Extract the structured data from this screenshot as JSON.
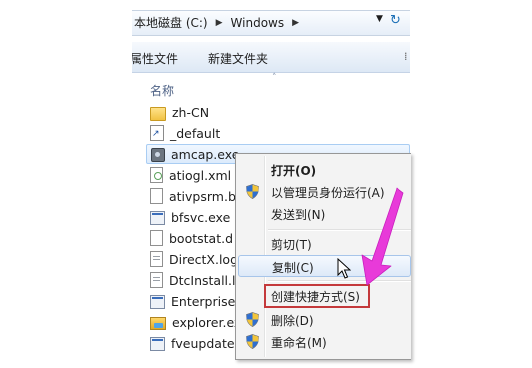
{
  "address": {
    "crumbs": [
      "本地磁盘 (C:)",
      "Windows"
    ],
    "separator_glyph": "▶",
    "dropdown_glyph": "▼",
    "refresh_glyph": "↻"
  },
  "toolbar": {
    "properties_label": "属性文件",
    "new_folder_label": "新建文件夹",
    "overflow_glyph": "⁞"
  },
  "list_header": {
    "name_label": "名称",
    "sort_glyph": "˄"
  },
  "files": [
    {
      "name": "zh-CN",
      "icon": "folder"
    },
    {
      "name": "_default",
      "icon": "shortcut"
    },
    {
      "name": "amcap.exe",
      "icon": "camera-exe",
      "selected": true
    },
    {
      "name": "atiogl.xml",
      "icon": "xml"
    },
    {
      "name": "ativpsrm.b",
      "icon": "document"
    },
    {
      "name": "bfsvc.exe",
      "icon": "exe"
    },
    {
      "name": "bootstat.d",
      "icon": "document"
    },
    {
      "name": "DirectX.log",
      "icon": "log"
    },
    {
      "name": "DtcInstall.l",
      "icon": "log"
    },
    {
      "name": "Enterprise.",
      "icon": "exe"
    },
    {
      "name": "explorer.ex",
      "icon": "explorer"
    },
    {
      "name": "fveupdate.",
      "icon": "exe"
    }
  ],
  "context_menu": {
    "items": [
      {
        "label": "打开(O)",
        "bold": true,
        "icon": ""
      },
      {
        "label": "以管理员身份运行(A)",
        "icon": "uac-shield-icon"
      },
      {
        "label": "发送到(N)",
        "icon": ""
      },
      {
        "label": "剪切(T)",
        "icon": ""
      },
      {
        "label": "复制(C)",
        "icon": "",
        "hover": true
      },
      {
        "label": "创建快捷方式(S)",
        "icon": "",
        "highlighted": true
      },
      {
        "label": "删除(D)",
        "icon": "uac-shield-icon"
      },
      {
        "label": "重命名(M)",
        "icon": "uac-shield-icon"
      }
    ]
  },
  "colors": {
    "annotation_arrow": "#e83ad9",
    "highlight_box": "#c4393b",
    "selection": "#dcebfc",
    "header_text": "#4d6185"
  }
}
